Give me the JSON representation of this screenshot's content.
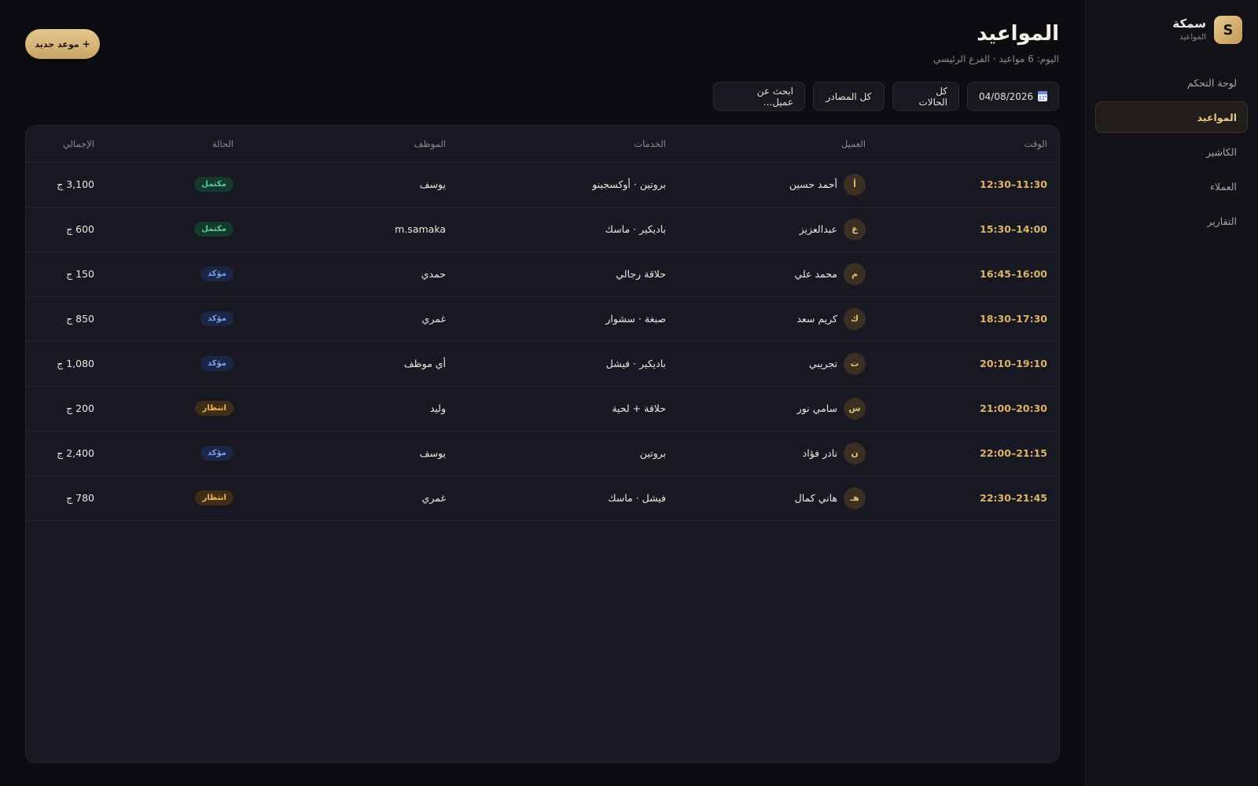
{
  "sidebar": {
    "brand_logo": "S",
    "brand_name": "سمكة",
    "brand_sub": "المواعيد",
    "items": [
      {
        "label": "لوحة التحكم",
        "active": false
      },
      {
        "label": "المواعيد",
        "active": true
      },
      {
        "label": "الكاشير",
        "active": false
      },
      {
        "label": "العملاء",
        "active": false
      },
      {
        "label": "التقارير",
        "active": false
      }
    ]
  },
  "header": {
    "title": "المواعيد",
    "subtitle": "اليوم: 6 مواعيد · الفرع الرئيسي",
    "new_button": "موعد جديد",
    "new_button_icon": "+"
  },
  "filters": {
    "date": "04/08/2026",
    "date_icon": "calendar-icon",
    "status": "كل الحالات",
    "source": "كل المصادر",
    "search_placeholder": "ابحث عن عميل..."
  },
  "table": {
    "headers": {
      "time": "الوقت",
      "client": "العميل",
      "services": "الخدمات",
      "staff": "الموظف",
      "status": "الحالة",
      "total": "الإجمالي"
    },
    "rows": [
      {
        "time": "11:30–12:30",
        "initial": "أ",
        "client": "أحمد حسين",
        "services": "بروتين · أوكسجينو",
        "staff": "يوسف",
        "status": "مكتمل",
        "status_type": "completed",
        "total": "3,100 ج"
      },
      {
        "time": "14:00–15:30",
        "initial": "ع",
        "client": "عبدالعزيز",
        "services": "باديكير · ماسك",
        "staff": "m.samaka",
        "status": "مكتمل",
        "status_type": "completed",
        "total": "600 ج"
      },
      {
        "time": "16:00–16:45",
        "initial": "م",
        "client": "محمد علي",
        "services": "حلاقة رجالي",
        "staff": "حمدي",
        "status": "مؤكد",
        "status_type": "confirmed",
        "total": "150 ج"
      },
      {
        "time": "17:30–18:30",
        "initial": "ك",
        "client": "كريم سعد",
        "services": "صبغة · سشوار",
        "staff": "غمري",
        "status": "مؤكد",
        "status_type": "confirmed",
        "total": "850 ج"
      },
      {
        "time": "19:10–20:10",
        "initial": "ت",
        "client": "تجريبي",
        "services": "باديكير · فيشل",
        "staff": "أي موظف",
        "status": "مؤكد",
        "status_type": "confirmed",
        "total": "1,080 ج"
      },
      {
        "time": "20:30–21:00",
        "initial": "س",
        "client": "سامي نور",
        "services": "حلاقة + لحية",
        "staff": "وليد",
        "status": "انتظار",
        "status_type": "waiting",
        "total": "200 ج"
      },
      {
        "time": "21:15–22:00",
        "initial": "ن",
        "client": "نادر فؤاد",
        "services": "بروتين",
        "staff": "يوسف",
        "status": "مؤكد",
        "status_type": "confirmed",
        "total": "2,400 ج"
      },
      {
        "time": "21:45–22:30",
        "initial": "هـ",
        "client": "هاني كمال",
        "services": "فيشل · ماسك",
        "staff": "غمري",
        "status": "انتظار",
        "status_type": "waiting",
        "total": "780 ج"
      }
    ]
  },
  "colors": {
    "accent": "#e0b466",
    "completed": "#4fcf9c",
    "confirmed": "#78a2f0",
    "waiting": "#f0b856"
  }
}
